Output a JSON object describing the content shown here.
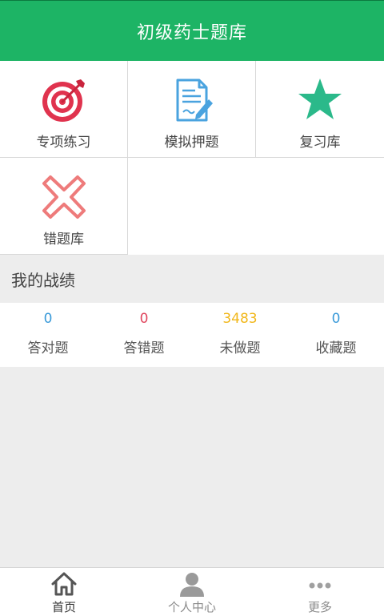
{
  "header": {
    "title": "初级药士题库"
  },
  "grid": {
    "items": [
      {
        "label": "专项练习",
        "icon": "target-icon"
      },
      {
        "label": "模拟押题",
        "icon": "document-pen-icon"
      },
      {
        "label": "复习库",
        "icon": "star-icon"
      },
      {
        "label": "错题库",
        "icon": "cross-icon"
      }
    ]
  },
  "record": {
    "title": "我的战绩",
    "stats": [
      {
        "value": "0",
        "label": "答对题",
        "color": "#3a9ad9"
      },
      {
        "value": "0",
        "label": "答错题",
        "color": "#e0465e"
      },
      {
        "value": "3483",
        "label": "未做题",
        "color": "#f1b71a"
      },
      {
        "value": "0",
        "label": "收藏题",
        "color": "#3a9ad9"
      }
    ]
  },
  "tabs": [
    {
      "label": "首页",
      "icon": "home-icon",
      "active": true
    },
    {
      "label": "个人中心",
      "icon": "person-icon",
      "active": false
    },
    {
      "label": "更多",
      "icon": "more-icon",
      "active": false
    }
  ],
  "colors": {
    "brand": "#1db465",
    "target_red": "#e0334e",
    "doc_blue": "#4aa3df",
    "star_green": "#2bb98a",
    "cross_pink": "#ee7b7b"
  }
}
